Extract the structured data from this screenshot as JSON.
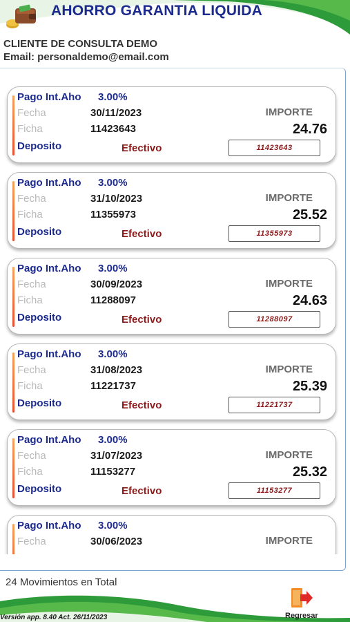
{
  "header": {
    "title": "AHORRO GARANTIA LIQUIDA"
  },
  "client": {
    "name": "CLIENTE DE CONSULTA DEMO",
    "email": "Email: personaldemo@email.com"
  },
  "labels": {
    "fecha": "Fecha",
    "ficha": "Ficha",
    "importe": "IMPORTE"
  },
  "movements": [
    {
      "type": "Pago Int.Aho",
      "rate": "3.00%",
      "date": "30/11/2023",
      "ficha": "11423643",
      "movement": "Deposito",
      "method": "Efectivo",
      "amount": "24.76",
      "reference": "11423643"
    },
    {
      "type": "Pago Int.Aho",
      "rate": "3.00%",
      "date": "31/10/2023",
      "ficha": "11355973",
      "movement": "Deposito",
      "method": "Efectivo",
      "amount": "25.52",
      "reference": "11355973"
    },
    {
      "type": "Pago Int.Aho",
      "rate": "3.00%",
      "date": "30/09/2023",
      "ficha": "11288097",
      "movement": "Deposito",
      "method": "Efectivo",
      "amount": "24.63",
      "reference": "11288097"
    },
    {
      "type": "Pago Int.Aho",
      "rate": "3.00%",
      "date": "31/08/2023",
      "ficha": "11221737",
      "movement": "Deposito",
      "method": "Efectivo",
      "amount": "25.39",
      "reference": "11221737"
    },
    {
      "type": "Pago Int.Aho",
      "rate": "3.00%",
      "date": "31/07/2023",
      "ficha": "11153277",
      "movement": "Deposito",
      "method": "Efectivo",
      "amount": "25.32",
      "reference": "11153277"
    },
    {
      "type": "Pago Int.Aho",
      "rate": "3.00%",
      "date": "30/06/2023",
      "ficha": "",
      "movement": "",
      "method": "",
      "amount": "",
      "reference": ""
    }
  ],
  "summary": {
    "total": "24 Movimientos en Total"
  },
  "footer": {
    "version": "Versión app. 8.40 Act. 26/11/2023",
    "back_label": "Regresar"
  },
  "colors": {
    "brand_blue": "#1b2a8c",
    "accent_green": "#2e9b3a",
    "method_red": "#8b1a1a",
    "accent_orange": "#e8502f"
  }
}
